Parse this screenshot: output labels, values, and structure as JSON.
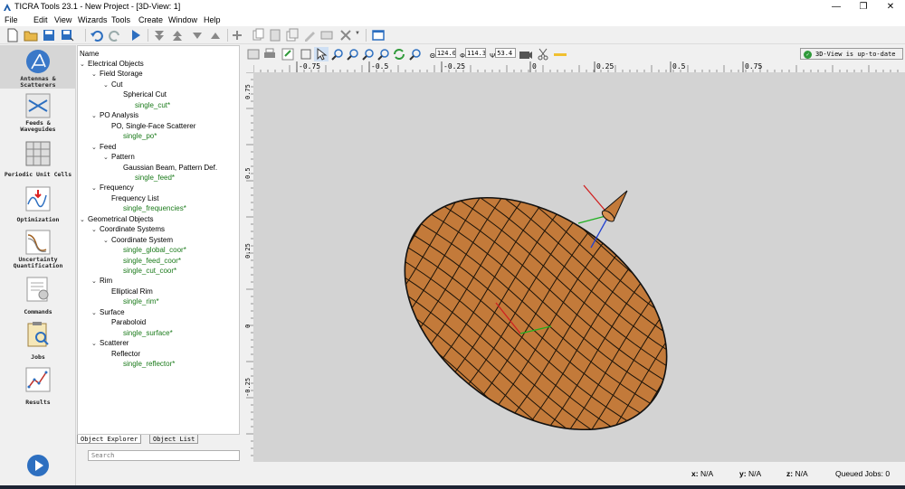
{
  "window": {
    "title": "TICRA Tools 23.1  - New Project  - [3D-View: 1]",
    "minimize": "—",
    "maximize": "❐",
    "close": "✕"
  },
  "menu": [
    "File",
    "Edit",
    "View",
    "Wizards",
    "Tools",
    "Create",
    "Window",
    "Help"
  ],
  "sidebar": [
    {
      "label": "Antennas &\nScatterers",
      "icon": "antenna-icon",
      "active": true
    },
    {
      "label": "Feeds &\nWaveguides",
      "icon": "feed-icon"
    },
    {
      "label": "Periodic Unit Cells",
      "icon": "unit-cell-icon"
    },
    {
      "label": "Optimization",
      "icon": "optimization-icon"
    },
    {
      "label": "Uncertainty\nQuantification",
      "icon": "uncertainty-icon"
    },
    {
      "label": "Commands",
      "icon": "commands-icon"
    },
    {
      "label": "Jobs",
      "icon": "jobs-icon"
    },
    {
      "label": "Results",
      "icon": "results-icon"
    }
  ],
  "tree": {
    "header": "Name",
    "rows": [
      {
        "t": "Electrical Objects",
        "d": 0,
        "c": true
      },
      {
        "t": "Field Storage",
        "d": 1,
        "c": true
      },
      {
        "t": "Cut",
        "d": 2,
        "c": true
      },
      {
        "t": "Spherical Cut",
        "d": 3,
        "c": false
      },
      {
        "t": "single_cut*",
        "d": 4,
        "c": false,
        "g": true
      },
      {
        "t": "PO Analysis",
        "d": 1,
        "c": true
      },
      {
        "t": "PO, Single-Face Scatterer",
        "d": 2,
        "c": false
      },
      {
        "t": "single_po*",
        "d": 3,
        "c": false,
        "g": true
      },
      {
        "t": "Feed",
        "d": 1,
        "c": true
      },
      {
        "t": "Pattern",
        "d": 2,
        "c": true
      },
      {
        "t": "Gaussian Beam, Pattern Def.",
        "d": 3,
        "c": false
      },
      {
        "t": "single_feed*",
        "d": 4,
        "c": false,
        "g": true
      },
      {
        "t": "Frequency",
        "d": 1,
        "c": true
      },
      {
        "t": "Frequency List",
        "d": 2,
        "c": false
      },
      {
        "t": "single_frequencies*",
        "d": 3,
        "c": false,
        "g": true
      },
      {
        "t": "Geometrical Objects",
        "d": 0,
        "c": true
      },
      {
        "t": "Coordinate Systems",
        "d": 1,
        "c": true
      },
      {
        "t": "Coordinate System",
        "d": 2,
        "c": true
      },
      {
        "t": "single_global_coor*",
        "d": 3,
        "c": false,
        "g": true
      },
      {
        "t": "single_feed_coor*",
        "d": 3,
        "c": false,
        "g": true
      },
      {
        "t": "single_cut_coor*",
        "d": 3,
        "c": false,
        "g": true
      },
      {
        "t": "Rim",
        "d": 1,
        "c": true
      },
      {
        "t": "Elliptical Rim",
        "d": 2,
        "c": false
      },
      {
        "t": "single_rim*",
        "d": 3,
        "c": false,
        "g": true
      },
      {
        "t": "Surface",
        "d": 1,
        "c": true
      },
      {
        "t": "Paraboloid",
        "d": 2,
        "c": false
      },
      {
        "t": "single_surface*",
        "d": 3,
        "c": false,
        "g": true
      },
      {
        "t": "Scatterer",
        "d": 1,
        "c": true
      },
      {
        "t": "Reflector",
        "d": 2,
        "c": false
      },
      {
        "t": "single_reflector*",
        "d": 3,
        "c": false,
        "g": true
      }
    ]
  },
  "tabs": [
    "Object Explorer",
    "Object List"
  ],
  "search": {
    "placeholder": "Search"
  },
  "view": {
    "theta_label": "Θ",
    "theta": "124.0",
    "phi_label": "Φ",
    "phi": "114.3",
    "psi_label": "Ψ",
    "psi": "53.4",
    "status": "3D-View is up-to-date"
  },
  "ruler_x": [
    "-0.75",
    "-0.5",
    "-0.25",
    "0",
    "0.25",
    "0.5",
    "0.75"
  ],
  "ruler_y": [
    "0.75",
    "0.5",
    "0.25",
    "0",
    "-0.25"
  ],
  "statusbar": {
    "x_label": "x:",
    "x": "N/A",
    "y_label": "y:",
    "y": "N/A",
    "z_label": "z:",
    "z": "N/A",
    "queued_label": "Queued Jobs:",
    "queued": "0"
  },
  "colors": {
    "reflector": "#c37a3a",
    "green_text": "#1a7a1a",
    "canvas": "#d3d3d3"
  }
}
